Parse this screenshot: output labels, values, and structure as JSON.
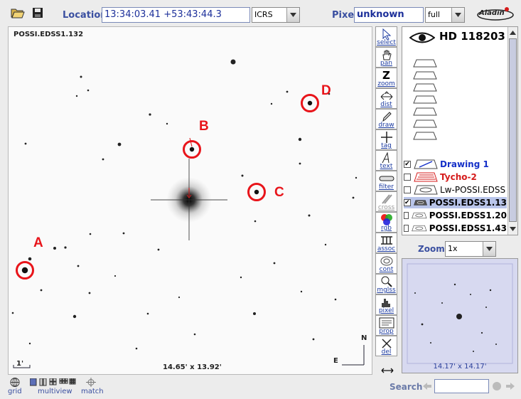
{
  "topbar": {
    "open_icon": "folder-open-icon",
    "save_icon": "floppy-disk-icon",
    "location_label": "Location",
    "location_value": "13:34:03.41 +53:43:44.3",
    "frame_value": "ICRS",
    "pixel_label": "Pixel",
    "pixel_value": "unknown",
    "pixel_mode": "full",
    "logo_text": "Aladin"
  },
  "view": {
    "image_label": "POSSI.EDSS1.132",
    "scale_label": "1'",
    "fov_label": "14.65' x 13.92'",
    "compass_n": "N",
    "compass_e": "E",
    "markers": [
      {
        "label": "A"
      },
      {
        "label": "B"
      },
      {
        "label": "C"
      },
      {
        "label": "D"
      }
    ]
  },
  "toolbar": {
    "tools": [
      {
        "label": "select",
        "icon": "select-arrow-icon",
        "enabled": true
      },
      {
        "label": "pan",
        "icon": "hand-icon",
        "enabled": true
      },
      {
        "label": "zoom",
        "icon": "zoom-z-icon",
        "enabled": true
      },
      {
        "label": "dist",
        "icon": "distance-icon",
        "enabled": true
      },
      {
        "label": "draw",
        "icon": "pencil-icon",
        "enabled": true
      },
      {
        "label": "tag",
        "icon": "crosshair-icon",
        "enabled": true
      },
      {
        "label": "text",
        "icon": "text-icon",
        "enabled": true
      },
      {
        "label": "filter",
        "icon": "filter-icon",
        "enabled": true
      },
      {
        "label": "cross",
        "icon": "cross-icon",
        "enabled": false
      },
      {
        "label": "rgb",
        "icon": "rgb-icon",
        "enabled": true
      },
      {
        "label": "assoc",
        "icon": "assoc-icon",
        "enabled": true
      },
      {
        "label": "cont",
        "icon": "contour-icon",
        "enabled": true
      },
      {
        "label": "mglss",
        "icon": "magnifier-icon",
        "enabled": true
      },
      {
        "label": "pixel",
        "icon": "histogram-icon",
        "enabled": true
      },
      {
        "label": "prop",
        "icon": "properties-icon",
        "enabled": true
      },
      {
        "label": "del",
        "icon": "delete-x-icon",
        "enabled": true
      }
    ],
    "move_icon": "move-arrows-icon"
  },
  "stack": {
    "object_name": "HD 118203",
    "eye_icon": "eye-icon",
    "empty_planes": 7,
    "layers": [
      {
        "name": "Drawing 1",
        "checked": true,
        "color": "#1530c8",
        "selected": false
      },
      {
        "name": "Tycho-2",
        "checked": false,
        "color": "#d51b1b",
        "selected": false
      },
      {
        "name": "Lw-POSSI.EDSS",
        "checked": false,
        "color": "#000000",
        "selected": false
      },
      {
        "name": "POSSI.EDSS1.13",
        "checked": true,
        "color": "#000000",
        "selected": true
      },
      {
        "name": "POSSI.EDSS1.20",
        "checked": false,
        "color": "#000000",
        "selected": false
      },
      {
        "name": "POSSI.EDSS1.43",
        "checked": false,
        "color": "#000000",
        "selected": false
      }
    ]
  },
  "zoom": {
    "label": "Zoom",
    "value": "1x",
    "preview_fov": "14.17' x 14.17'"
  },
  "bottom": {
    "grid_label": "grid",
    "multiview_label": "multiview",
    "match_label": "match",
    "search_label": "Search",
    "search_value": ""
  },
  "colors": {
    "accent_blue": "#3a4fa0",
    "marker_red": "#e8141a",
    "preview_bg": "#d7d9f0"
  }
}
